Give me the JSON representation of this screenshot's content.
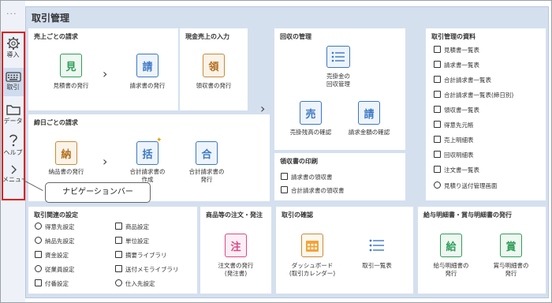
{
  "sidebar": {
    "more_label": "···",
    "items": [
      {
        "label": "導入",
        "icon": "gear-icon"
      },
      {
        "label": "取引",
        "icon": "keyboard-icon"
      },
      {
        "label": "データ",
        "icon": "folder-icon"
      },
      {
        "label": "ヘルプ",
        "icon": "help-icon"
      },
      {
        "label": "メニュー",
        "icon": "chevron-right-icon"
      }
    ],
    "tooltip": "ナビゲーションバー"
  },
  "main": {
    "title": "取引管理",
    "sections": {
      "sales": {
        "title": "売上ごとの請求",
        "items": [
          {
            "icon_text": "見",
            "label": "見積書の発行"
          },
          {
            "icon_text": "請",
            "label": "請求書の発行"
          }
        ]
      },
      "cash_sales": {
        "title": "現金売上の入力",
        "items": [
          {
            "icon_text": "領",
            "label": "領収書の発行"
          }
        ]
      },
      "closing": {
        "title": "締日ごとの請求",
        "items": [
          {
            "icon_text": "納",
            "label1": "納品書の発行",
            "label2": ""
          },
          {
            "icon_text": "括",
            "label1": "合計請求書の",
            "label2": "作成"
          },
          {
            "icon_text": "合",
            "label1": "合計請求書の",
            "label2": "発行"
          }
        ]
      },
      "collection": {
        "title": "回収の管理",
        "items": [
          {
            "label1": "売掛金の",
            "label2": "回収管理"
          },
          {
            "icon_text": "売",
            "label": "売掛残高の確認"
          },
          {
            "icon_text": "請",
            "label": "請求金額の確認"
          }
        ]
      },
      "receipt_print": {
        "title": "領収書の印刷",
        "items": [
          "請求書の領収書",
          "合計請求書の領収書"
        ]
      },
      "materials": {
        "title": "取引管理の資料",
        "items": [
          "見積書一覧表",
          "請求書一覧表",
          "合計請求書一覧表",
          "合計請求書一覧表(締日別)",
          "領収書一覧表",
          "得意先元帳",
          "売上明細表",
          "回収明細表",
          "注文書一覧表",
          "見積り送付管理画面"
        ]
      },
      "settings": {
        "title": "取引関連の設定",
        "left": [
          "得意先設定",
          "納品先設定",
          "資金設定",
          "従業員設定",
          "付番設定"
        ],
        "right": [
          "商品設定",
          "単位設定",
          "摘要ライブラリ",
          "送付メモライブラリ",
          "仕入先設定"
        ]
      },
      "orders": {
        "title": "商品等の注文・発注",
        "items": [
          {
            "icon_text": "注",
            "label1": "注文書の発行",
            "label2": "(発注書)"
          }
        ]
      },
      "confirm": {
        "title": "取引の確認",
        "items": [
          {
            "label1": "ダッシュボード",
            "label2": "(取引カレンダー)"
          },
          {
            "label1": "取引一覧表",
            "label2": ""
          }
        ]
      },
      "payroll": {
        "title": "給与明細書・賞与明細書の発行",
        "items": [
          {
            "icon_text": "給",
            "label1": "給与明細書の",
            "label2": "発行"
          },
          {
            "icon_text": "賞",
            "label1": "賞与明細書の",
            "label2": "発行"
          }
        ]
      }
    }
  }
}
